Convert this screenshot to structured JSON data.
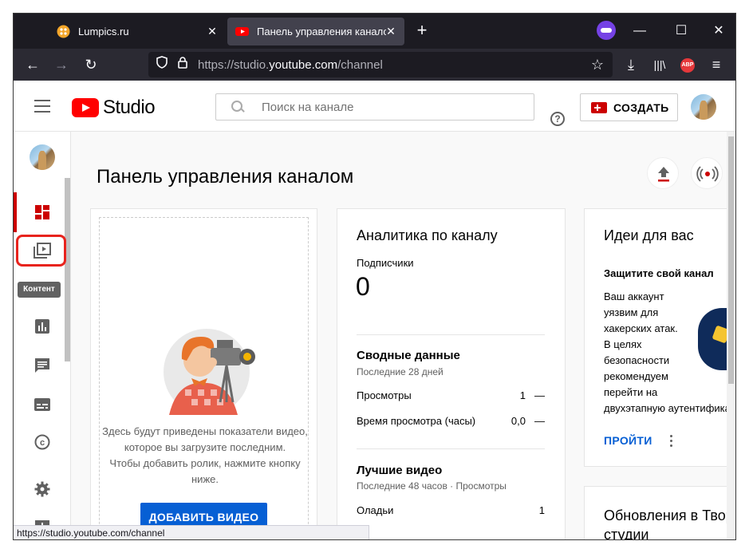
{
  "browser": {
    "tabs": [
      {
        "title": "Lumpics.ru",
        "close": "✕"
      },
      {
        "title": "Панель управления каналом",
        "close": "✕"
      }
    ],
    "new_tab": "+",
    "url_scheme": "https://studio.",
    "url_domain": "youtube.com",
    "url_path": "/channel",
    "status_url": "https://studio.youtube.com/channel",
    "abp_label": "ABP",
    "window_buttons": {
      "minimize": "—",
      "maximize": "☐",
      "close": "✕"
    }
  },
  "header": {
    "logo_text": "Studio",
    "search_placeholder": "Поиск на канале",
    "help": "?",
    "create_label": "СОЗДАТЬ"
  },
  "sidebar": {
    "tooltip": "Контент",
    "items": [
      {
        "name": "dashboard"
      },
      {
        "name": "content"
      },
      {
        "name": "analytics"
      },
      {
        "name": "comments"
      },
      {
        "name": "subtitles"
      },
      {
        "name": "copyright"
      },
      {
        "name": "settings"
      },
      {
        "name": "feedback"
      }
    ]
  },
  "main": {
    "title": "Панель управления каналом",
    "video_card": {
      "text": "Здесь будут приведены показатели видео, которое вы загрузите последним. Чтобы добавить ролик, нажмите кнопку ниже.",
      "lines": [
        "Здесь будут приведены показатели видео,",
        "которое вы загрузите последним.",
        "Чтобы добавить ролик, нажмите кнопку",
        "ниже."
      ],
      "button": "ДОБАВИТЬ ВИДЕО"
    },
    "analytics_card": {
      "title": "Аналитика по каналу",
      "subscribers_label": "Подписчики",
      "subscribers_value": "0",
      "summary_title": "Сводные данные",
      "summary_period": "Последние 28 дней",
      "rows": [
        {
          "label": "Просмотры",
          "value": "1",
          "delta": "—"
        },
        {
          "label": "Время просмотра (часы)",
          "value": "0,0",
          "delta": "—"
        }
      ],
      "top_title": "Лучшие видео",
      "top_period": "Последние 48 часов · Просмотры",
      "top_rows": [
        {
          "label": "Оладьи",
          "value": "1"
        }
      ]
    },
    "ideas_card": {
      "title": "Идеи для вас",
      "subtitle": "Защитите свой канал",
      "body_lines": [
        "Ваш аккаунт",
        "уязвим для",
        "хакерских атак.",
        "В целях",
        "безопасности",
        "рекомендуем",
        "перейти на",
        "двухэтапную аутентифика"
      ],
      "link": "ПРОЙТИ"
    },
    "updates_card": {
      "title_line1": "Обновления в Твор",
      "title_line2": "студии"
    }
  },
  "colors": {
    "brand_red": "#ff0000",
    "accent_blue": "#065fd4",
    "highlight_red": "#e8231d",
    "browser_dark": "#1c1b22"
  }
}
